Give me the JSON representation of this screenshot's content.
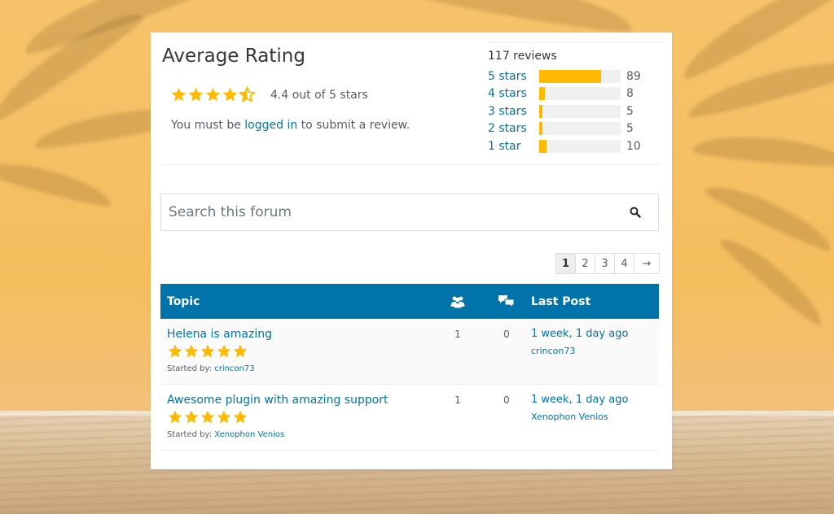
{
  "rating": {
    "title": "Average Rating",
    "stars_value": 4.4,
    "stars_max": 5,
    "summary": "4.4 out of 5 stars",
    "login_prefix": "You must be ",
    "login_link": "logged in",
    "login_suffix": " to submit a review."
  },
  "breakdown": {
    "total": "117 reviews",
    "rows": [
      {
        "label": "5 stars",
        "count": "89",
        "fraction": 0.76
      },
      {
        "label": "4 stars",
        "count": "8",
        "fraction": 0.07
      },
      {
        "label": "3 stars",
        "count": "5",
        "fraction": 0.04
      },
      {
        "label": "2 stars",
        "count": "5",
        "fraction": 0.04
      },
      {
        "label": "1 star",
        "count": "10",
        "fraction": 0.09
      }
    ]
  },
  "search": {
    "placeholder": "Search this forum",
    "icon": "search-icon"
  },
  "pagination": {
    "pages": [
      "1",
      "2",
      "3",
      "4"
    ],
    "current": "1",
    "next": "→"
  },
  "table": {
    "header_topic": "Topic",
    "header_voices_icon": "users-icon",
    "header_posts_icon": "comments-icon",
    "header_last": "Last Post",
    "rows": [
      {
        "title": "Helena is amazing",
        "stars": 5,
        "started_prefix": "Started by: ",
        "author": "crincon73",
        "voices": "1",
        "replies": "0",
        "freshness": "1 week, 1 day ago",
        "last_author": "crincon73"
      },
      {
        "title": "Awesome plugin with amazing support",
        "stars": 5,
        "started_prefix": "Started by: ",
        "author": "Xenophon Venios",
        "voices": "1",
        "replies": "0",
        "freshness": "1 week, 1 day ago",
        "last_author": "Xenophon Venios"
      }
    ]
  },
  "colors": {
    "accent": "#0073aa",
    "star": "#ffb900",
    "bar_bg": "#f0f0f0"
  }
}
